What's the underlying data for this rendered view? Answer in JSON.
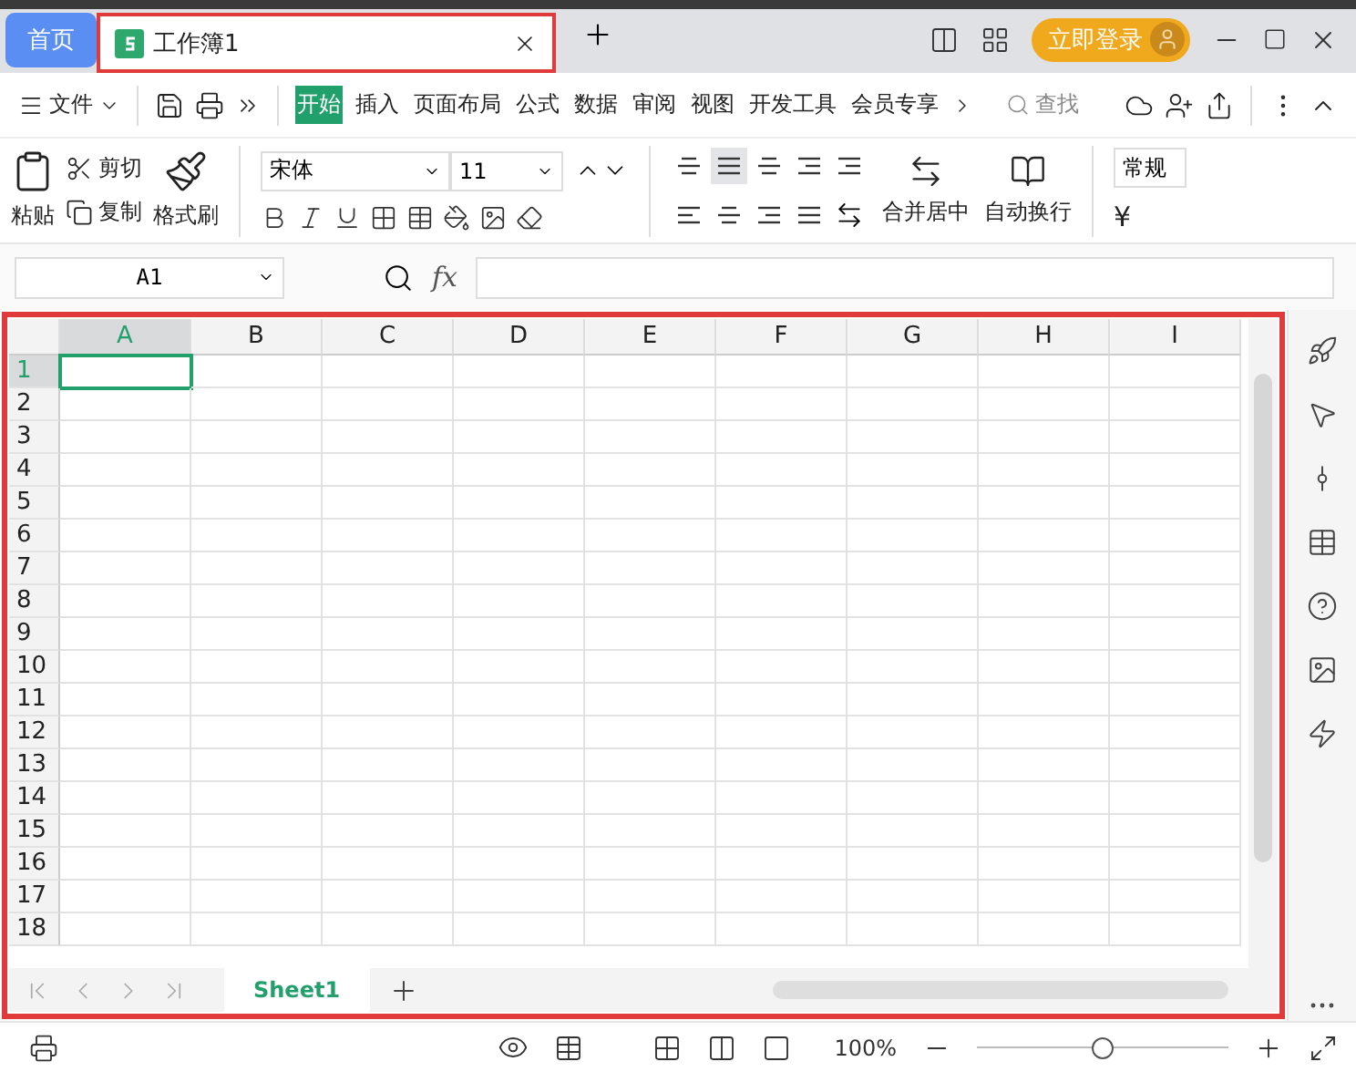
{
  "tabs": [
    {
      "kind": "home",
      "label": "首页",
      "selected": false,
      "highlighted": false
    },
    {
      "kind": "document",
      "label": "工作簿1",
      "selected": true,
      "highlighted": true
    }
  ],
  "login_button": "立即登录",
  "file_menu": "文件",
  "ribbon_tabs": [
    {
      "label": "开始",
      "selected": true
    },
    {
      "label": "插入",
      "selected": false
    },
    {
      "label": "页面布局",
      "selected": false
    },
    {
      "label": "公式",
      "selected": false
    },
    {
      "label": "数据",
      "selected": false
    },
    {
      "label": "审阅",
      "selected": false
    },
    {
      "label": "视图",
      "selected": false
    },
    {
      "label": "开发工具",
      "selected": false
    },
    {
      "label": "会员专享",
      "selected": false
    }
  ],
  "search": {
    "placeholder": "查找"
  },
  "clipboard": {
    "paste": "粘贴",
    "cut": "剪切",
    "copy": "复制",
    "format_painter": "格式刷"
  },
  "font": {
    "name": "宋体",
    "size": "11"
  },
  "alignment": {
    "merge": "合并居中",
    "wrap": "自动换行"
  },
  "number_format": {
    "value": "常规",
    "currency": "¥"
  },
  "name_box": "A1",
  "formula_label": "fx",
  "grid": {
    "highlighted": true
  },
  "columns": [
    {
      "label": "A",
      "selected": true
    },
    {
      "label": "B",
      "selected": false
    },
    {
      "label": "C",
      "selected": false
    },
    {
      "label": "D",
      "selected": false
    },
    {
      "label": "E",
      "selected": false
    },
    {
      "label": "F",
      "selected": false
    },
    {
      "label": "G",
      "selected": false
    },
    {
      "label": "H",
      "selected": false
    },
    {
      "label": "I",
      "selected": false
    }
  ],
  "rows": [
    {
      "label": "1",
      "selected": true
    },
    {
      "label": "2",
      "selected": false
    },
    {
      "label": "3",
      "selected": false
    },
    {
      "label": "4",
      "selected": false
    },
    {
      "label": "5",
      "selected": false
    },
    {
      "label": "6",
      "selected": false
    },
    {
      "label": "7",
      "selected": false
    },
    {
      "label": "8",
      "selected": false
    },
    {
      "label": "9",
      "selected": false
    },
    {
      "label": "10",
      "selected": false
    },
    {
      "label": "11",
      "selected": false
    },
    {
      "label": "12",
      "selected": false
    },
    {
      "label": "13",
      "selected": false
    },
    {
      "label": "14",
      "selected": false
    },
    {
      "label": "15",
      "selected": false
    },
    {
      "label": "16",
      "selected": false
    },
    {
      "label": "17",
      "selected": false
    },
    {
      "label": "18",
      "selected": false
    }
  ],
  "sheets": [
    {
      "label": "Sheet1",
      "selected": true
    }
  ],
  "zoom": {
    "reading": "100%",
    "level": 0.5
  }
}
